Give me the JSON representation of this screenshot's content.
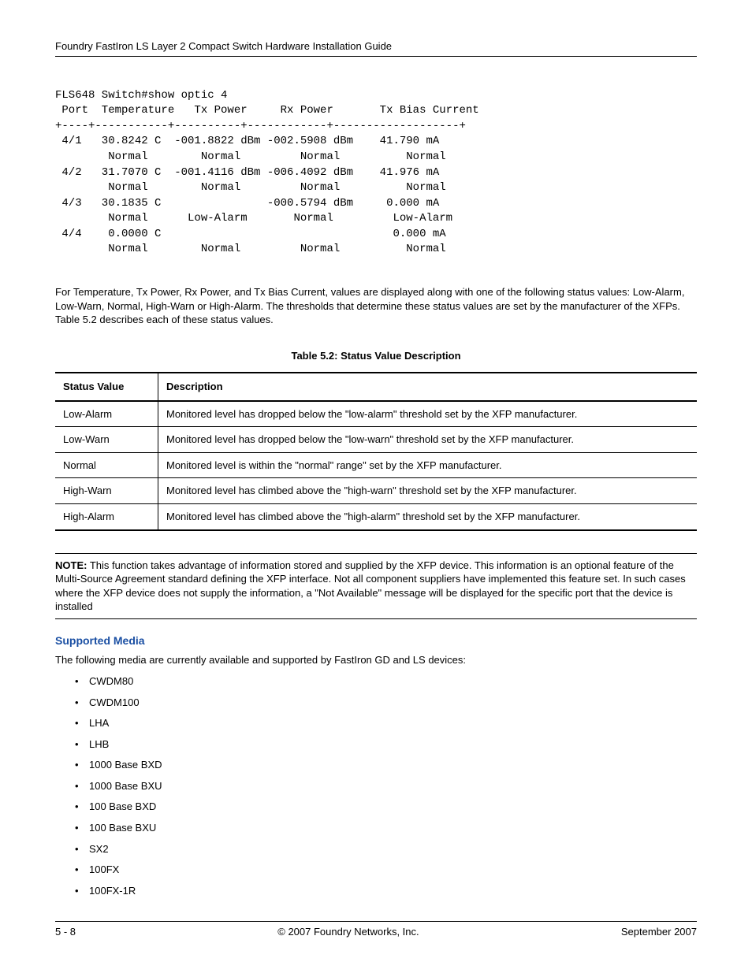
{
  "header": {
    "title": "Foundry FastIron LS Layer 2 Compact Switch Hardware Installation Guide"
  },
  "terminal": {
    "text": "FLS648 Switch#show optic 4\n Port  Temperature   Tx Power     Rx Power       Tx Bias Current\n+----+-----------+----------+------------+-------------------+\n 4/1   30.8242 C  -001.8822 dBm -002.5908 dBm    41.790 mA\n        Normal        Normal         Normal          Normal\n 4/2   31.7070 C  -001.4116 dBm -006.4092 dBm    41.976 mA\n        Normal        Normal         Normal          Normal\n 4/3   30.1835 C                -000.5794 dBm     0.000 mA\n        Normal      Low-Alarm       Normal         Low-Alarm\n 4/4    0.0000 C                                   0.000 mA\n        Normal        Normal         Normal          Normal"
  },
  "paragraph1": "For Temperature, Tx Power, Rx Power, and Tx Bias Current, values are displayed along with one of the following status values: Low-Alarm, Low-Warn, Normal, High-Warn or High-Alarm. The thresholds that determine these status values are set by the manufacturer of the XFPs. Table 5.2 describes each of these status values.",
  "table": {
    "caption": "Table 5.2: Status Value Description",
    "headers": {
      "c1": "Status Value",
      "c2": "Description"
    },
    "rows": [
      {
        "c1": "Low-Alarm",
        "c2": "Monitored level has dropped below the \"low-alarm\" threshold set by the XFP manufacturer."
      },
      {
        "c1": "Low-Warn",
        "c2": "Monitored level has dropped below the \"low-warn\" threshold set by the XFP manufacturer."
      },
      {
        "c1": "Normal",
        "c2": "Monitored level is within the \"normal\" range\" set by the XFP manufacturer."
      },
      {
        "c1": "High-Warn",
        "c2": "Monitored level has climbed above the \"high-warn\" threshold set by the XFP manufacturer."
      },
      {
        "c1": "High-Alarm",
        "c2": "Monitored level has climbed above  the \"high-alarm\" threshold set by the XFP manufacturer."
      }
    ]
  },
  "note": {
    "label": "NOTE:",
    "text": "This function takes advantage of information stored and supplied by the XFP device. This information is an optional feature of the Multi-Source Agreement standard defining the XFP interface. Not all component suppliers have implemented this feature set. In such cases where the XFP device does not supply the information, a \"Not Available\" message will be displayed for the specific port that the device is installed"
  },
  "section": {
    "heading": "Supported Media",
    "intro": "The following media are currently available and supported by FastIron GD and LS devices:",
    "items": [
      "CWDM80",
      "CWDM100",
      "LHA",
      "LHB",
      "1000 Base BXD",
      "1000 Base BXU",
      "100 Base BXD",
      "100 Base BXU",
      "SX2",
      "100FX",
      "100FX-1R"
    ]
  },
  "footer": {
    "left": "5 - 8",
    "center": "© 2007 Foundry Networks, Inc.",
    "right": "September 2007"
  }
}
